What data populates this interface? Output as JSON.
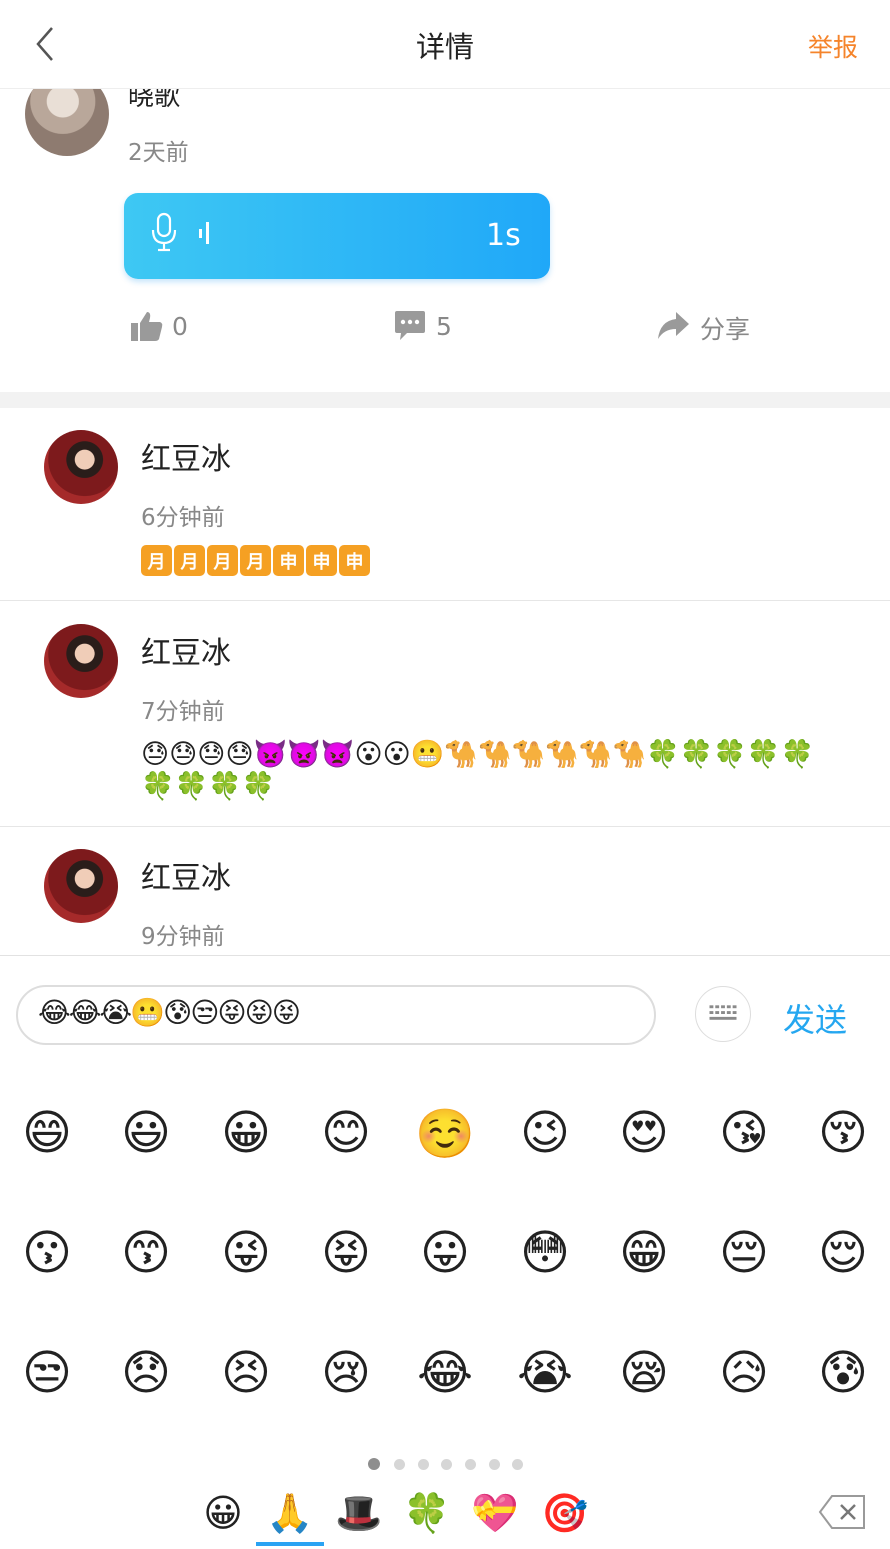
{
  "header": {
    "title": "详情",
    "report": "举报"
  },
  "post": {
    "name": "晓歌",
    "time": "2天前",
    "voice_duration": "1s",
    "likes": "0",
    "comments": "5",
    "share": "分享"
  },
  "comments": [
    {
      "name": "红豆冰",
      "time": "6分钟前",
      "badges": [
        "月",
        "月",
        "月",
        "月",
        "申",
        "申",
        "申"
      ]
    },
    {
      "name": "红豆冰",
      "time": "7分钟前",
      "line1": "😓😓😓😓👿👿👿😮😮😬🐪🐪🐪🐪🐪🐪🍀🍀🍀🍀🍀",
      "line2": "🍀🍀🍀🍀"
    },
    {
      "name": "红豆冰",
      "time": "9分钟前"
    }
  ],
  "input": {
    "text": "😂😂😭😬😰😒😝😝😝",
    "send": "发送"
  },
  "emoji_grid": [
    [
      "😄",
      "😃",
      "😀",
      "😊",
      "☺️",
      "😉",
      "😍",
      "😘",
      "😚"
    ],
    [
      "😗",
      "😙",
      "😜",
      "😝",
      "😛",
      "😳",
      "😁",
      "😔",
      "😌"
    ],
    [
      "😒",
      "😞",
      "😣",
      "😢",
      "😂",
      "😭",
      "😪",
      "😥",
      "😰"
    ]
  ],
  "categories": [
    "😀",
    "🙏",
    "🎩",
    "🍀",
    "💝",
    "🎯"
  ],
  "colors": {
    "accent": "#25a7f0",
    "report": "#f5842b"
  }
}
